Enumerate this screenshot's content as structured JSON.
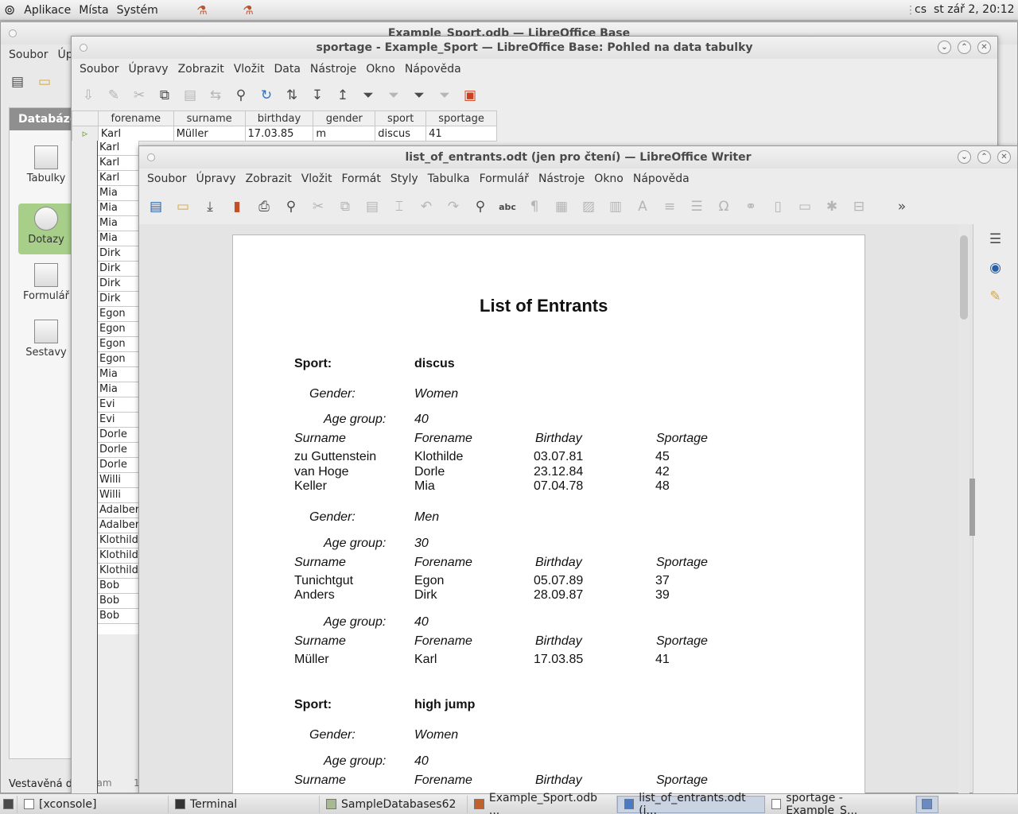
{
  "top_panel": {
    "menus": [
      "Aplikace",
      "Místa",
      "Systém"
    ],
    "lang": "cs",
    "clock": "st zář  2, 20:12"
  },
  "base_window": {
    "title": "Example_Sport.odb — LibreOffice Base",
    "menu_first": "Soubor",
    "menu_second": "Úpr",
    "sidebar_header": "Databáze",
    "sidebar_items": [
      "Tabulky",
      "Dotazy",
      "Formulář",
      "Sestavy"
    ],
    "status": "Vestavěná da"
  },
  "table_window": {
    "title": "sportage - Example_Sport — LibreOffice Base: Pohled na data tabulky",
    "menus": [
      "Soubor",
      "Úpravy",
      "Zobrazit",
      "Vložit",
      "Data",
      "Nástroje",
      "Okno",
      "Nápověda"
    ],
    "columns": [
      "forename",
      "surname",
      "birthday",
      "gender",
      "sport",
      "sportage"
    ],
    "first_row": [
      "Karl",
      "Müller",
      "17.03.85",
      "m",
      "discus",
      "41"
    ],
    "forenames": [
      "Karl",
      "Karl",
      "Karl",
      "Karl",
      "Mia",
      "Mia",
      "Mia",
      "Mia",
      "Dirk",
      "Dirk",
      "Dirk",
      "Dirk",
      "Egon",
      "Egon",
      "Egon",
      "Egon",
      "Mia",
      "Mia",
      "Evi",
      "Evi",
      "Dorle",
      "Dorle",
      "Dorle",
      "Willi",
      "Willi",
      "Adalber",
      "Adalber",
      "Klothild",
      "Klothild",
      "Klothild",
      "Bob",
      "Bob",
      "Bob"
    ],
    "status_label": "Záznam",
    "status_value": "1"
  },
  "writer_window": {
    "title": "list_of_entrants.odt (jen pro čtení) — LibreOffice Writer",
    "menus": [
      "Soubor",
      "Úpravy",
      "Zobrazit",
      "Vložit",
      "Formát",
      "Styly",
      "Tabulka",
      "Formulář",
      "Nástroje",
      "Okno",
      "Nápověda"
    ]
  },
  "document": {
    "title": "List of Entrants",
    "labels": {
      "sport": "Sport:",
      "gender": "Gender:",
      "age_group": "Age group:"
    },
    "headers": [
      "Surname",
      "Forename",
      "Birthday",
      "Sportage"
    ],
    "sport1": "discus",
    "g1": "Women",
    "g1_age": "40",
    "g1_rows": [
      [
        "zu Guttenstein",
        "Klothilde",
        "03.07.81",
        "45"
      ],
      [
        "van Hoge",
        "Dorle",
        "23.12.84",
        "42"
      ],
      [
        "Keller",
        "Mia",
        "07.04.78",
        "48"
      ]
    ],
    "g2": "Men",
    "g2_age1": "30",
    "g2_rows1": [
      [
        "Tunichtgut",
        "Egon",
        "05.07.89",
        "37"
      ],
      [
        "Anders",
        "Dirk",
        "28.09.87",
        "39"
      ]
    ],
    "g2_age2": "40",
    "g2_rows2": [
      [
        "Müller",
        "Karl",
        "17.03.85",
        "41"
      ]
    ],
    "sport2": "high jump",
    "g3": "Women",
    "g3_age": "40"
  },
  "taskbar": {
    "items": [
      "[xconsole]",
      "Terminal",
      "SampleDatabases62",
      "Example_Sport.odb ...",
      "list_of_entrants.odt (j...",
      "sportage - Example_S..."
    ]
  }
}
